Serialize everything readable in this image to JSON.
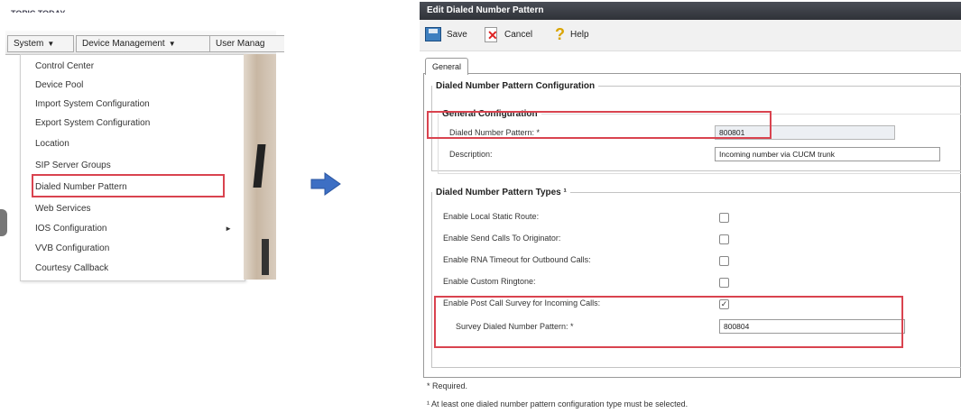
{
  "left_menu": {
    "header_cut": "TOPIC TODAY",
    "top_menus": [
      {
        "label": "System"
      },
      {
        "label": "Device Management"
      },
      {
        "label": "User Manag"
      }
    ],
    "dropdown_items": [
      {
        "label": "Control Center"
      },
      {
        "label": "Device Pool"
      },
      {
        "label": "Import System Configuration"
      },
      {
        "label": "Export System Configuration"
      },
      {
        "label": "Location"
      },
      {
        "label": "SIP Server Groups"
      },
      {
        "label": "Dialed Number Pattern"
      },
      {
        "label": "Web Services"
      },
      {
        "label": "IOS Configuration",
        "has_submenu": true
      },
      {
        "label": "VVB Configuration"
      },
      {
        "label": "Courtesy Callback"
      }
    ]
  },
  "editor": {
    "title": "Edit Dialed Number Pattern",
    "toolbar": {
      "save_label": "Save",
      "cancel_label": "Cancel",
      "help_label": "Help"
    },
    "tab_general": "General",
    "config_section": {
      "legend": "Dialed Number Pattern Configuration",
      "general_legend": "General Configuration",
      "pattern_label": "Dialed Number Pattern: *",
      "pattern_value": "800801",
      "description_label": "Description:",
      "description_value": "Incoming number via CUCM trunk"
    },
    "types_section": {
      "legend": "Dialed Number Pattern Types ¹",
      "rows": [
        {
          "label": "Enable Local Static Route:",
          "checked": false
        },
        {
          "label": "Enable Send Calls To Originator:",
          "checked": false
        },
        {
          "label": "Enable RNA Timeout for Outbound Calls:",
          "checked": false
        },
        {
          "label": "Enable Custom Ringtone:",
          "checked": false
        },
        {
          "label": "Enable Post Call Survey for Incoming Calls:",
          "checked": true
        }
      ],
      "survey_label": "Survey Dialed Number Pattern: *",
      "survey_value": "800804"
    },
    "footnotes": {
      "required": "* Required.",
      "note": "¹ At least one dialed number pattern configuration type must be selected."
    }
  },
  "colors": {
    "highlight": "#d9434f",
    "arrow": "#3d6fc4",
    "titlebar": "#3a3d44"
  }
}
